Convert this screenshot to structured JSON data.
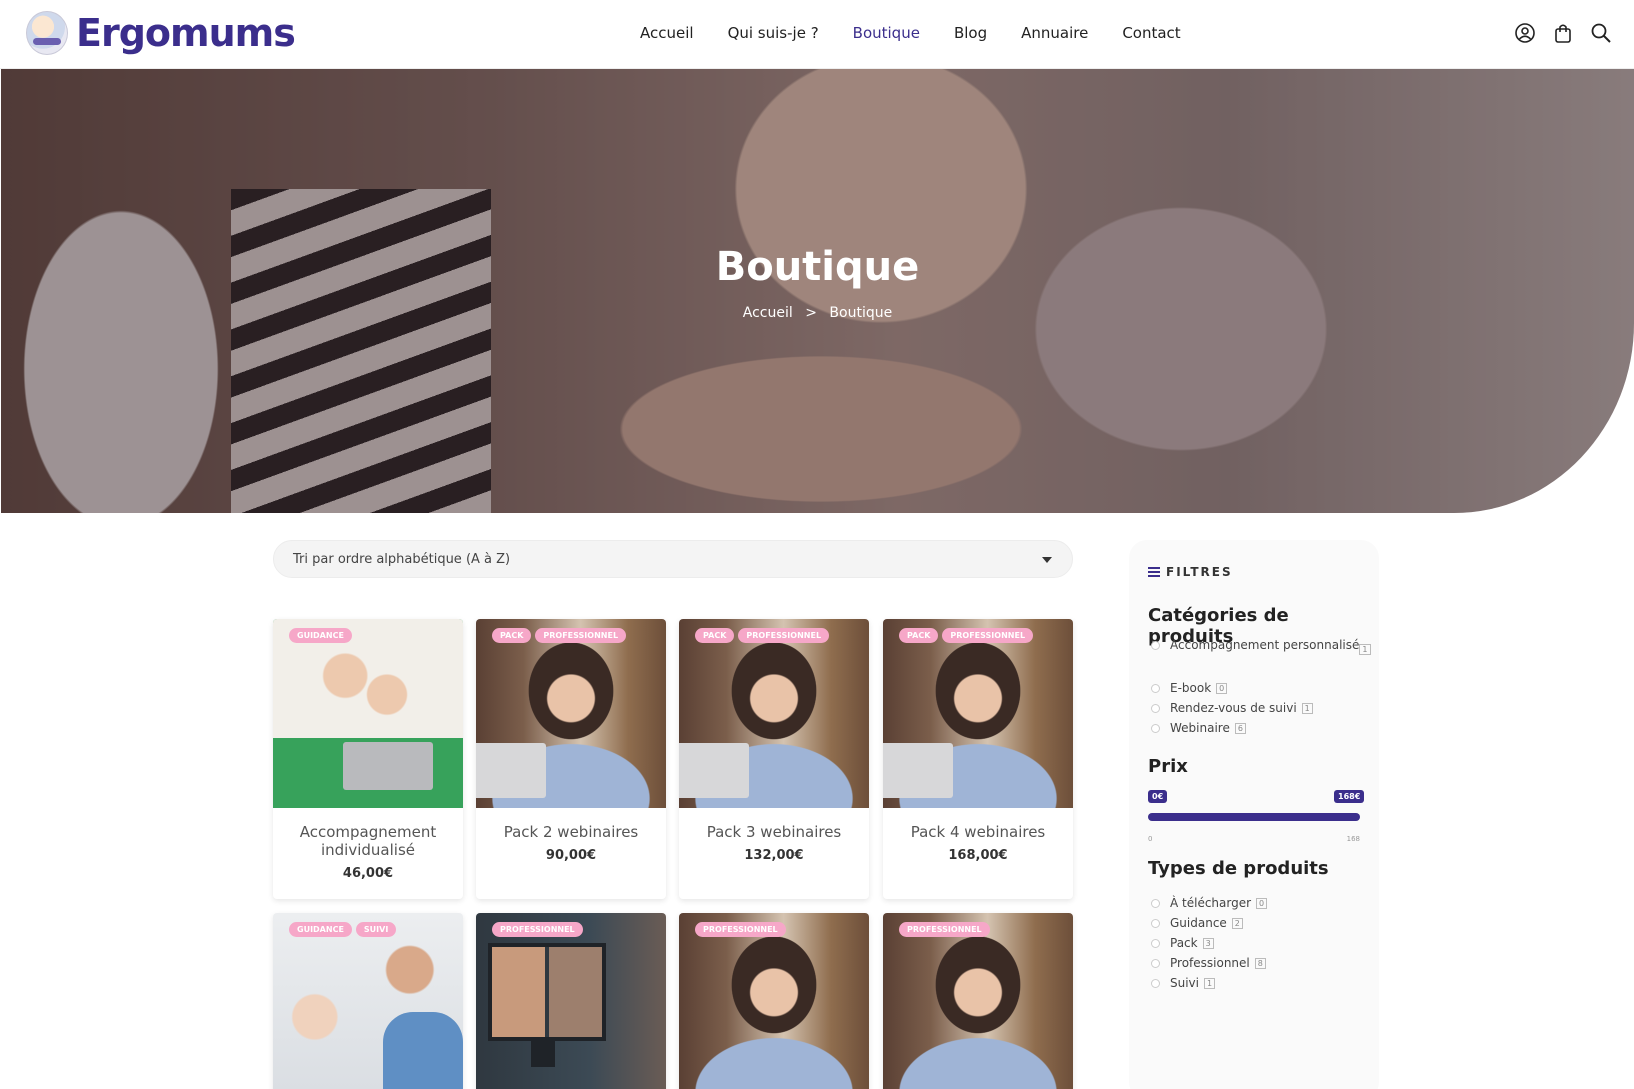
{
  "brand": {
    "name": "Ergomums",
    "accent": "#3b2e8c",
    "badge_color": "#f6a7c8"
  },
  "nav": [
    {
      "label": "Accueil"
    },
    {
      "label": "Qui suis-je ?"
    },
    {
      "label": "Boutique",
      "active": true
    },
    {
      "label": "Blog"
    },
    {
      "label": "Annuaire"
    },
    {
      "label": "Contact"
    }
  ],
  "header_icons": [
    "user-icon",
    "cart-icon",
    "search-icon"
  ],
  "hero": {
    "title": "Boutique",
    "breadcrumb": {
      "home": "Accueil",
      "separator": ">",
      "current": "Boutique"
    }
  },
  "sort": {
    "selected": "Tri par ordre alphabétique (A à Z)"
  },
  "products": [
    {
      "badges": [
        "GUIDANCE"
      ],
      "name": "Accompagnement individualisé",
      "price": "46,00€"
    },
    {
      "badges": [
        "PACK",
        "PROFESSIONNEL"
      ],
      "name": "Pack 2 webinaires",
      "price": "90,00€"
    },
    {
      "badges": [
        "PACK",
        "PROFESSIONNEL"
      ],
      "name": "Pack 3 webinaires",
      "price": "132,00€"
    },
    {
      "badges": [
        "PACK",
        "PROFESSIONNEL"
      ],
      "name": "Pack 4 webinaires",
      "price": "168,00€"
    },
    {
      "badges": [
        "GUIDANCE",
        "SUIVI"
      ]
    },
    {
      "badges": [
        "PROFESSIONNEL"
      ]
    },
    {
      "badges": [
        "PROFESSIONNEL"
      ]
    },
    {
      "badges": [
        "PROFESSIONNEL"
      ]
    }
  ],
  "sidebar": {
    "filters_label": "FILTRES",
    "categories": {
      "title": "Catégories de produits",
      "items": [
        {
          "label": "Accompagnement personnalisé",
          "count": "1"
        },
        {
          "label": "E-book",
          "count": "0"
        },
        {
          "label": "Rendez-vous de suivi",
          "count": "1"
        },
        {
          "label": "Webinaire",
          "count": "6"
        }
      ]
    },
    "price": {
      "title": "Prix",
      "min_label": "0€",
      "max_label": "168€",
      "tick_min": "0",
      "tick_max": "168",
      "range_min": 0,
      "range_max": 168
    },
    "types": {
      "title": "Types de produits",
      "items": [
        {
          "label": "À télécharger",
          "count": "0"
        },
        {
          "label": "Guidance",
          "count": "2"
        },
        {
          "label": "Pack",
          "count": "3"
        },
        {
          "label": "Professionnel",
          "count": "8"
        },
        {
          "label": "Suivi",
          "count": "1"
        }
      ]
    }
  }
}
